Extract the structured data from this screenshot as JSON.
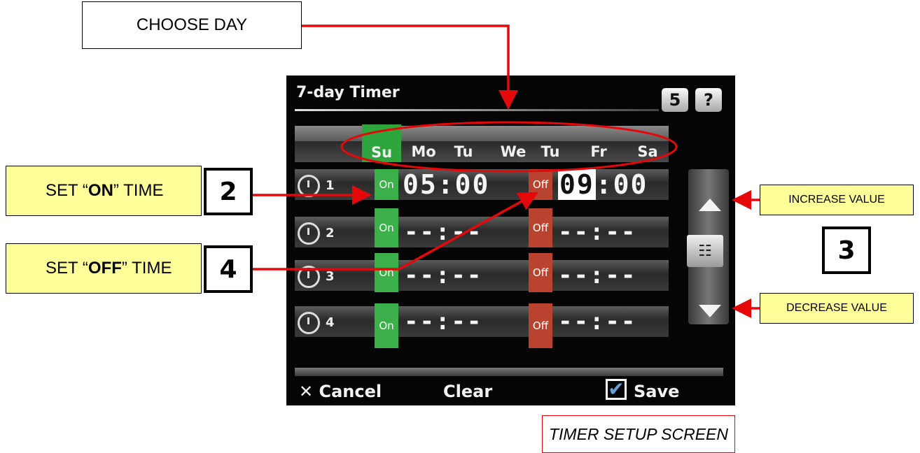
{
  "callouts": {
    "choose_day": "CHOOSE DAY",
    "set_on_prefix": "SET “",
    "set_on_bold": "ON",
    "set_on_suffix": "” TIME",
    "set_off_prefix": "SET “",
    "set_off_bold": "OFF",
    "set_off_suffix": "” TIME",
    "increase": "INCREASE VALUE",
    "decrease": "DECREASE VALUE",
    "caption": "TIMER SETUP SCREEN",
    "num_2": "2",
    "num_3": "3",
    "num_4": "4"
  },
  "screen": {
    "title": "7-day Timer",
    "back_icon": "back-arrow-icon",
    "back_glyph": "5",
    "help_icon": "help-icon",
    "help_glyph": "?",
    "days": [
      "Su",
      "Mo",
      "Tu",
      "We",
      "Tu",
      "Fr",
      "Sa"
    ],
    "active_day": "Su",
    "active_color": "#2ea53d",
    "rows": [
      {
        "num": "1",
        "on": "On",
        "on_time": "05:00",
        "off": "Off",
        "off_time_h": "09",
        "off_time_m": ":00"
      },
      {
        "num": "2",
        "on": "On",
        "on_time": "--:--",
        "off": "Off",
        "off_time": "--:--"
      },
      {
        "num": "3",
        "on": "On",
        "on_time": "--:--",
        "off": "Off",
        "off_time": "--:--"
      },
      {
        "num": "4",
        "on": "On",
        "on_time": "--:--",
        "off": "Off",
        "off_time": "--:--"
      }
    ],
    "keypad_glyph": "☷",
    "cancel_glyph": "✕",
    "cancel": "Cancel",
    "clear": "Clear",
    "save_glyph": "✔",
    "save": "Save",
    "on_color": "#3cb04a",
    "off_color": "#b9432f"
  },
  "annotation_color": "#e4080a"
}
